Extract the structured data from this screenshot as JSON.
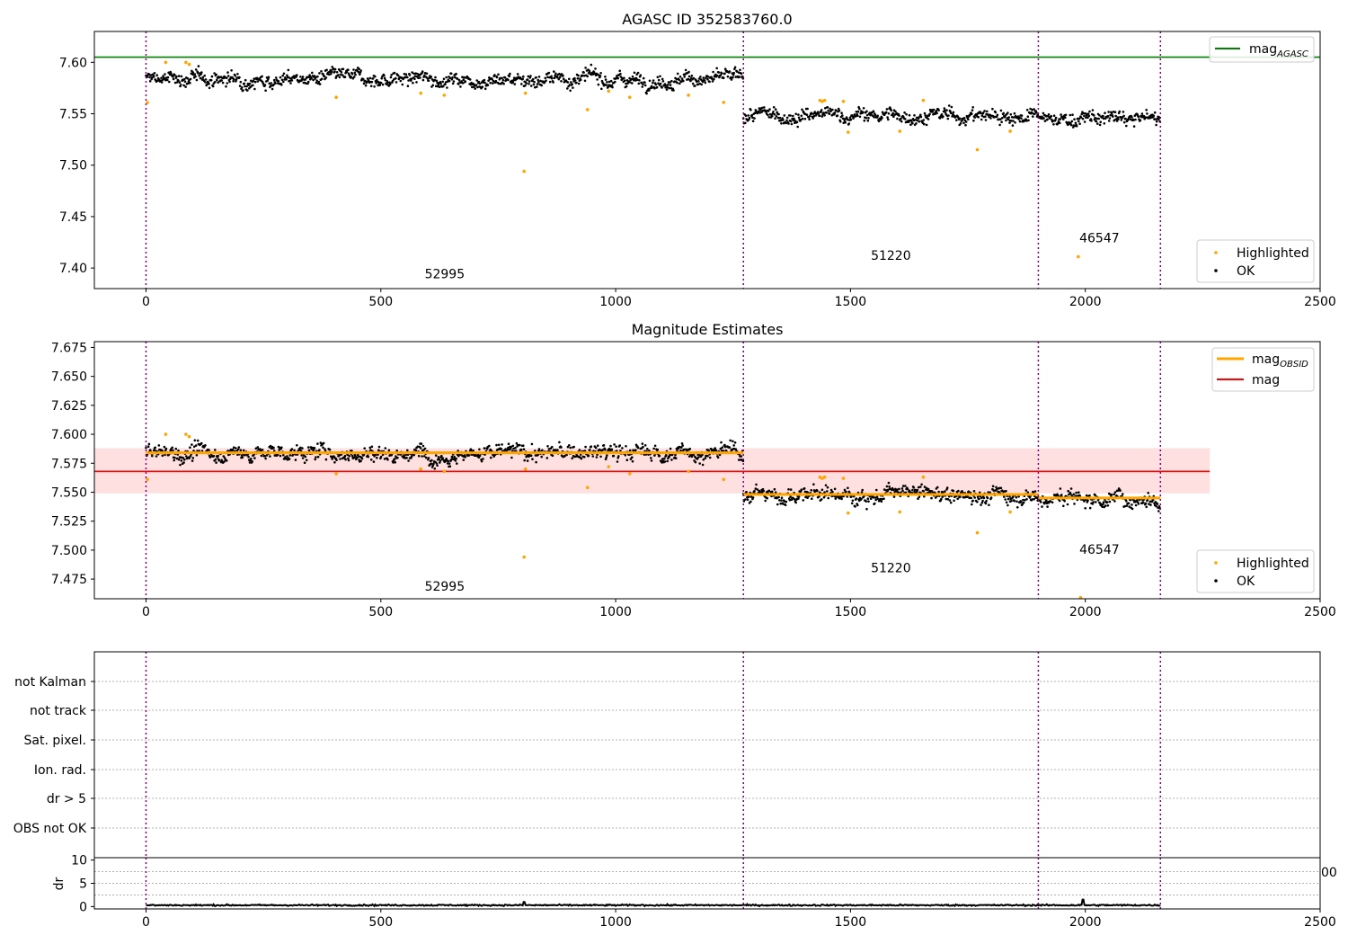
{
  "chart_data": [
    {
      "type": "scatter",
      "title": "AGASC ID 352583760.0",
      "xlim": [
        -110,
        2500
      ],
      "ylim": [
        7.38,
        7.63
      ],
      "xticks": [
        0,
        500,
        1000,
        1500,
        2000,
        2500
      ],
      "yticks": [
        7.4,
        7.45,
        7.5,
        7.55,
        7.6
      ],
      "ytick_labels": [
        "7.40",
        "7.45",
        "7.50",
        "7.55",
        "7.60"
      ],
      "obs_boundaries": [
        0,
        1272,
        1900,
        2160
      ],
      "obs_labels": [
        {
          "text": "52995",
          "x": 636,
          "y": 7.39
        },
        {
          "text": "51220",
          "x": 1586,
          "y": 7.408
        },
        {
          "text": "46547",
          "x": 2030,
          "y": 7.425
        }
      ],
      "reference_lines": [
        {
          "name": "magAGASC",
          "value": 7.605,
          "color": "#008000",
          "x_range": [
            -110,
            2500
          ]
        }
      ],
      "legend_lines": [
        {
          "label_main": "mag",
          "label_sub": "AGASC",
          "color": "#008000"
        }
      ],
      "legend_points": [
        {
          "label": "Highlighted",
          "color": "#ffa500"
        },
        {
          "label": "OK",
          "color": "#000000"
        }
      ],
      "ok_segments": [
        {
          "x0": 0,
          "x1": 1272,
          "level": 7.584,
          "spread": 0.005
        },
        {
          "x0": 1272,
          "x1": 1900,
          "level": 7.548,
          "spread": 0.005
        },
        {
          "x0": 1900,
          "x1": 2160,
          "level": 7.545,
          "spread": 0.005
        }
      ],
      "highlighted_points": [
        [
          3,
          7.561
        ],
        [
          42,
          7.6
        ],
        [
          85,
          7.6
        ],
        [
          92,
          7.598
        ],
        [
          405,
          7.566
        ],
        [
          585,
          7.57
        ],
        [
          635,
          7.568
        ],
        [
          805,
          7.494
        ],
        [
          808,
          7.57
        ],
        [
          940,
          7.554
        ],
        [
          985,
          7.572
        ],
        [
          1030,
          7.566
        ],
        [
          1155,
          7.568
        ],
        [
          1230,
          7.561
        ],
        [
          1435,
          7.563
        ],
        [
          1440,
          7.562
        ],
        [
          1445,
          7.563
        ],
        [
          1485,
          7.562
        ],
        [
          1495,
          7.532
        ],
        [
          1605,
          7.533
        ],
        [
          1655,
          7.563
        ],
        [
          1770,
          7.515
        ],
        [
          1840,
          7.533
        ],
        [
          1985,
          7.411
        ]
      ]
    },
    {
      "type": "scatter",
      "title": "Magnitude Estimates",
      "xlim": [
        -110,
        2500
      ],
      "ylim": [
        7.458,
        7.68
      ],
      "xticks": [
        0,
        500,
        1000,
        1500,
        2000,
        2500
      ],
      "yticks": [
        7.475,
        7.5,
        7.525,
        7.55,
        7.575,
        7.6,
        7.625,
        7.65,
        7.675
      ],
      "ytick_labels": [
        "7.475",
        "7.500",
        "7.525",
        "7.550",
        "7.575",
        "7.600",
        "7.625",
        "7.650",
        "7.675"
      ],
      "obs_boundaries": [
        0,
        1272,
        1900,
        2160
      ],
      "obs_labels": [
        {
          "text": "52995",
          "x": 636,
          "y": 7.465
        },
        {
          "text": "51220",
          "x": 1586,
          "y": 7.481
        },
        {
          "text": "46547",
          "x": 2030,
          "y": 7.497
        }
      ],
      "band": {
        "low": 7.549,
        "high": 7.588,
        "x_range": [
          -110,
          2265
        ],
        "color": "#ffcccc"
      },
      "reference_lines": [
        {
          "name": "mag",
          "value": 7.568,
          "color": "#ff0000",
          "x_range": [
            -110,
            2265
          ]
        }
      ],
      "obsid_steps": [
        {
          "x0": 0,
          "x1": 1272,
          "value": 7.584
        },
        {
          "x0": 1272,
          "x1": 1900,
          "value": 7.548
        },
        {
          "x0": 1900,
          "x1": 2160,
          "value": 7.545
        }
      ],
      "legend_lines": [
        {
          "label_main": "mag",
          "label_sub": "OBSID",
          "color": "#ffa500"
        },
        {
          "label_main": "mag",
          "label_sub": "",
          "color": "#ff0000"
        }
      ],
      "legend_points": [
        {
          "label": "Highlighted",
          "color": "#ffa500"
        },
        {
          "label": "OK",
          "color": "#000000"
        }
      ],
      "ok_segments": [
        {
          "x0": 0,
          "x1": 1272,
          "level": 7.584,
          "spread": 0.005
        },
        {
          "x0": 1272,
          "x1": 1900,
          "level": 7.548,
          "spread": 0.005
        },
        {
          "x0": 1900,
          "x1": 2160,
          "level": 7.545,
          "spread": 0.005
        }
      ],
      "highlighted_points": [
        [
          3,
          7.561
        ],
        [
          42,
          7.6
        ],
        [
          85,
          7.6
        ],
        [
          92,
          7.598
        ],
        [
          405,
          7.566
        ],
        [
          585,
          7.57
        ],
        [
          635,
          7.568
        ],
        [
          805,
          7.494
        ],
        [
          808,
          7.57
        ],
        [
          940,
          7.554
        ],
        [
          985,
          7.572
        ],
        [
          1030,
          7.566
        ],
        [
          1155,
          7.568
        ],
        [
          1230,
          7.561
        ],
        [
          1435,
          7.563
        ],
        [
          1440,
          7.562
        ],
        [
          1445,
          7.563
        ],
        [
          1485,
          7.562
        ],
        [
          1495,
          7.532
        ],
        [
          1605,
          7.533
        ],
        [
          1655,
          7.563
        ],
        [
          1770,
          7.515
        ],
        [
          1840,
          7.533
        ],
        [
          1990,
          7.459
        ]
      ]
    },
    {
      "type": "table",
      "title": "",
      "xlim": [
        -110,
        2500
      ],
      "obs_boundaries": [
        0,
        1272,
        1900,
        2160
      ],
      "flag_categories": [
        "not Kalman",
        "not track",
        "Sat. pixel.",
        "Ion. rad.",
        "dr > 5",
        "OBS not OK"
      ],
      "flag_points": []
    },
    {
      "type": "line",
      "title": "",
      "ylabel": "dr",
      "xlim": [
        -110,
        2500
      ],
      "ylim": [
        -0.5,
        10.5
      ],
      "xticks": [
        0,
        500,
        1000,
        1500,
        2000,
        2500
      ],
      "yticks": [
        0,
        5,
        10
      ],
      "ytick_labels": [
        "0",
        "5",
        "10"
      ],
      "obs_boundaries": [
        0,
        1272,
        1900,
        2160
      ],
      "overflow_label": "00",
      "dr_level": 0.3,
      "dr_spikes": [
        [
          805,
          1.0
        ],
        [
          1995,
          1.5
        ]
      ]
    }
  ],
  "tick_labels_x": [
    "0",
    "500",
    "1000",
    "1500",
    "2000",
    "2500"
  ],
  "colors": {
    "ok_points": "#000000",
    "highlighted_points": "#ffa500",
    "obs_boundary": "#800080",
    "axes": "#000000",
    "grid_dotted": "#b0b0b0"
  }
}
